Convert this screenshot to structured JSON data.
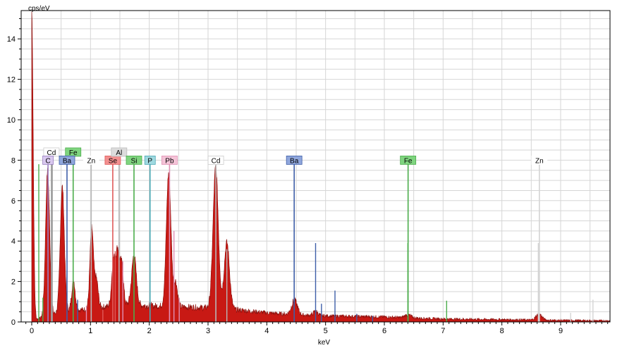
{
  "chart_data": {
    "type": "area",
    "xlabel": "keV",
    "ylabel": "cps/eV",
    "xlim": [
      -0.18,
      9.84
    ],
    "ylim": [
      0,
      15.4
    ],
    "x_ticks": [
      0,
      1,
      2,
      3,
      4,
      5,
      6,
      7,
      8,
      9
    ],
    "y_ticks": [
      0,
      2,
      4,
      6,
      8,
      10,
      12,
      14
    ],
    "x_minor_step": 0.1,
    "y_minor_step": 0.5,
    "grid": true,
    "colors": {
      "spectrum_fill": "#c81914",
      "spectrum_edge": "#8a0d0a",
      "grid": "#d6d6d6",
      "axis": "#000000"
    },
    "spectrum": {
      "background": [
        [
          0,
          0.05
        ],
        [
          0.5,
          0.5
        ],
        [
          1.0,
          0.65
        ],
        [
          1.5,
          0.85
        ],
        [
          2.0,
          0.8
        ],
        [
          2.5,
          0.75
        ],
        [
          3.0,
          0.7
        ],
        [
          3.5,
          0.6
        ],
        [
          4.0,
          0.45
        ],
        [
          4.5,
          0.35
        ],
        [
          5.0,
          0.3
        ],
        [
          6.0,
          0.25
        ],
        [
          7.0,
          0.15
        ],
        [
          8.0,
          0.12
        ],
        [
          9.0,
          0.08
        ],
        [
          9.84,
          0.06
        ]
      ],
      "peaks": [
        {
          "x": 0.0,
          "h": 15.3,
          "w": 0.025
        },
        {
          "x": 0.27,
          "h": 7.2,
          "w": 0.035
        },
        {
          "x": 0.52,
          "h": 6.2,
          "w": 0.035
        },
        {
          "x": 0.71,
          "h": 1.5,
          "w": 0.03
        },
        {
          "x": 1.02,
          "h": 4.0,
          "w": 0.03
        },
        {
          "x": 1.1,
          "h": 1.4,
          "w": 0.03
        },
        {
          "x": 1.39,
          "h": 2.2,
          "w": 0.03
        },
        {
          "x": 1.46,
          "h": 2.6,
          "w": 0.03
        },
        {
          "x": 1.53,
          "h": 2.0,
          "w": 0.03
        },
        {
          "x": 1.74,
          "h": 2.5,
          "w": 0.04
        },
        {
          "x": 2.33,
          "h": 6.6,
          "w": 0.04
        },
        {
          "x": 2.45,
          "h": 1.2,
          "w": 0.03
        },
        {
          "x": 3.13,
          "h": 7.0,
          "w": 0.045
        },
        {
          "x": 3.32,
          "h": 3.3,
          "w": 0.045
        },
        {
          "x": 4.47,
          "h": 0.7,
          "w": 0.05
        },
        {
          "x": 4.83,
          "h": 0.2,
          "w": 0.04
        },
        {
          "x": 6.4,
          "h": 0.15,
          "w": 0.05
        },
        {
          "x": 8.63,
          "h": 0.3,
          "w": 0.05
        }
      ]
    },
    "lines": [
      {
        "element": "Fe",
        "x": 0.705,
        "y": 8.0,
        "color": "#4cad4c"
      },
      {
        "element": "Cd",
        "x": 0.335,
        "y": 7.8,
        "color": "#9e9e9e"
      },
      {
        "element": "C",
        "x": 0.277,
        "y": 7.8,
        "color": "#9a7fc0"
      },
      {
        "element": "Ba",
        "x": 0.6,
        "y": 7.8,
        "color": "#3f5fa8"
      },
      {
        "element": "Zn",
        "x": 1.012,
        "y": 7.8,
        "color": "#b8b8b8"
      },
      {
        "element": "Se",
        "x": 1.379,
        "y": 7.8,
        "color": "#e05a5a"
      },
      {
        "element": "Al",
        "x": 1.486,
        "y": 8.0,
        "color": "#b8b8b8"
      },
      {
        "element": "Si",
        "x": 1.74,
        "y": 7.8,
        "color": "#4cad4c"
      },
      {
        "element": "P",
        "x": 2.013,
        "y": 7.8,
        "color": "#4aa8b4"
      },
      {
        "element": "Pb",
        "x": 2.345,
        "y": 7.8,
        "color": "#e091b4"
      },
      {
        "element": "Cd",
        "x": 3.133,
        "y": 7.8,
        "color": "#b8b8b8"
      },
      {
        "element": "Ba",
        "x": 4.466,
        "y": 7.8,
        "color": "#3f5fa8"
      },
      {
        "element": "Fe",
        "x": 6.404,
        "y": 7.8,
        "color": "#4cad4c"
      },
      {
        "element": "Zn",
        "x": 8.638,
        "y": 7.8,
        "color": "#d4d4d4"
      }
    ],
    "minor_lines": [
      {
        "x": 0.12,
        "y": 7.8,
        "color": "#4cad4c"
      },
      {
        "x": 0.35,
        "y": 7.8,
        "color": "#9e9e9e"
      },
      {
        "x": 0.19,
        "y": 1.2,
        "color": "#4cad4c"
      },
      {
        "x": 0.78,
        "y": 1.1,
        "color": "#3f5fa8"
      },
      {
        "x": 0.93,
        "y": 0.8,
        "color": "#e091b4"
      },
      {
        "x": 1.21,
        "y": 0.6,
        "color": "#e05a5a"
      },
      {
        "x": 1.42,
        "y": 3.5,
        "color": "#e05a5a"
      },
      {
        "x": 1.55,
        "y": 3.0,
        "color": "#e091b4"
      },
      {
        "x": 2.42,
        "y": 4.5,
        "color": "#e091b4"
      },
      {
        "x": 2.51,
        "y": 1.2,
        "color": "#e091b4"
      },
      {
        "x": 3.32,
        "y": 3.6,
        "color": "#b8b8b8"
      },
      {
        "x": 4.83,
        "y": 3.9,
        "color": "#3f5fa8"
      },
      {
        "x": 4.93,
        "y": 0.9,
        "color": "#3f5fa8"
      },
      {
        "x": 5.16,
        "y": 1.55,
        "color": "#3f5fa8"
      },
      {
        "x": 5.53,
        "y": 0.4,
        "color": "#3f5fa8"
      },
      {
        "x": 5.8,
        "y": 0.3,
        "color": "#3f5fa8"
      },
      {
        "x": 6.4,
        "y": 3.9,
        "color": "#4cad4c"
      },
      {
        "x": 7.06,
        "y": 1.05,
        "color": "#4cad4c"
      },
      {
        "x": 8.62,
        "y": 3.9,
        "color": "#d4d4d4"
      },
      {
        "x": 9.17,
        "y": 0.45,
        "color": "#d4d4d4"
      },
      {
        "x": 9.55,
        "y": 1.1,
        "color": "#d4d4d4"
      }
    ],
    "labels": [
      {
        "text": "Cd",
        "x": 0.335,
        "y": 8.4,
        "bg": "#ffffff",
        "border": "#cccccc"
      },
      {
        "text": "Fe",
        "x": 0.705,
        "y": 8.4,
        "bg": "#7fd47f",
        "border": "#4cad4c"
      },
      {
        "text": "C",
        "x": 0.277,
        "y": 8.0,
        "bg": "#d9c8ef",
        "border": "#9a7fc0"
      },
      {
        "text": "Ba",
        "x": 0.6,
        "y": 8.0,
        "bg": "#8fa6dc",
        "border": "#3f5fa8"
      },
      {
        "text": "Zn",
        "x": 1.012,
        "y": 8.0,
        "bg": "#ffffff",
        "border": "#ffffff"
      },
      {
        "text": "Se",
        "x": 1.379,
        "y": 8.0,
        "bg": "#f28f8f",
        "border": "#e05a5a"
      },
      {
        "text": "Al",
        "x": 1.486,
        "y": 8.4,
        "bg": "#dcdcdc",
        "border": "#bbbbbb"
      },
      {
        "text": "Si",
        "x": 1.74,
        "y": 8.0,
        "bg": "#7fd47f",
        "border": "#4cad4c"
      },
      {
        "text": "P",
        "x": 2.013,
        "y": 8.0,
        "bg": "#9fd9e0",
        "border": "#4aa8b4"
      },
      {
        "text": "Pb",
        "x": 2.345,
        "y": 8.0,
        "bg": "#f4c3d7",
        "border": "#e091b4"
      },
      {
        "text": "Cd",
        "x": 3.133,
        "y": 8.0,
        "bg": "#ffffff",
        "border": "#cccccc"
      },
      {
        "text": "Ba",
        "x": 4.466,
        "y": 8.0,
        "bg": "#8fa6dc",
        "border": "#3f5fa8"
      },
      {
        "text": "Fe",
        "x": 6.404,
        "y": 8.0,
        "bg": "#7fd47f",
        "border": "#4cad4c"
      },
      {
        "text": "Zn",
        "x": 8.638,
        "y": 8.0,
        "bg": "#ffffff",
        "border": "#ffffff"
      }
    ]
  }
}
